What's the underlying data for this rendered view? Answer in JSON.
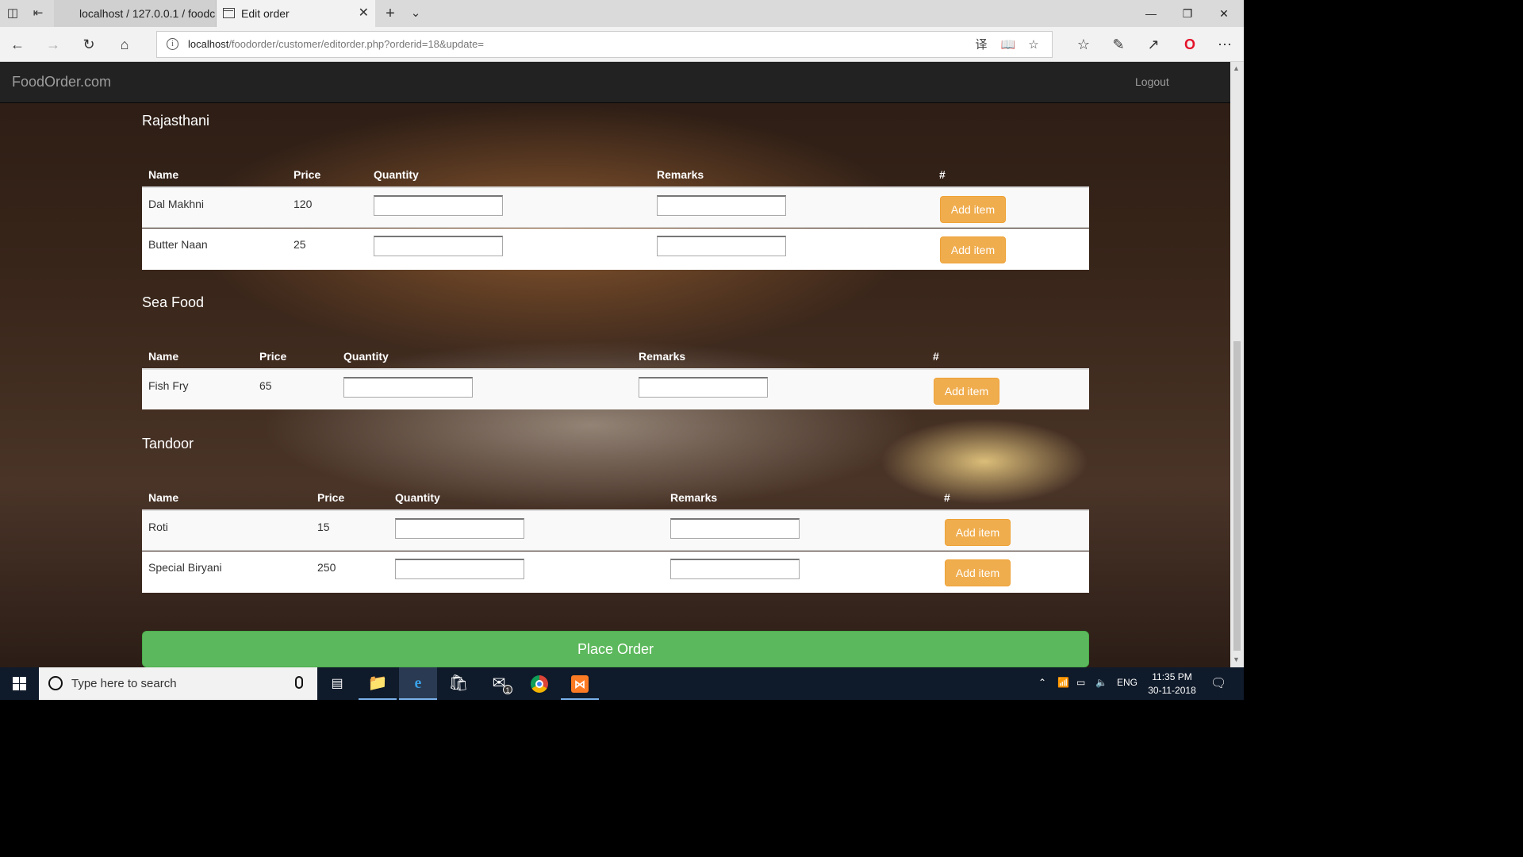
{
  "browser": {
    "tabs": [
      {
        "title": "localhost / 127.0.0.1 / foodc"
      },
      {
        "title": "Edit order"
      }
    ],
    "url_host": "localhost",
    "url_path": "/foodorder/customer/editorder.php?orderid=18&update="
  },
  "site": {
    "brand": "FoodOrder.com",
    "logout": "Logout"
  },
  "columns": {
    "name": "Name",
    "price": "Price",
    "quantity": "Quantity",
    "remarks": "Remarks",
    "hash": "#"
  },
  "add_label": "Add item",
  "sections": [
    {
      "title": "Rajasthani",
      "items": [
        {
          "name": "Dal Makhni",
          "price": "120"
        },
        {
          "name": "Butter Naan",
          "price": "25"
        }
      ]
    },
    {
      "title": "Sea Food",
      "items": [
        {
          "name": "Fish Fry",
          "price": "65"
        }
      ]
    },
    {
      "title": "Tandoor",
      "items": [
        {
          "name": "Roti",
          "price": "15"
        },
        {
          "name": "Special Biryani",
          "price": "250"
        }
      ]
    }
  ],
  "place_order": "Place Order",
  "taskbar": {
    "search_placeholder": "Type here to search",
    "language": "ENG",
    "time": "11:35 PM",
    "date": "30-11-2018",
    "mail_badge": "1"
  },
  "colors": {
    "add_button": "#f0ad4e",
    "place_order": "#5cb85c",
    "navbar": "#222222"
  }
}
